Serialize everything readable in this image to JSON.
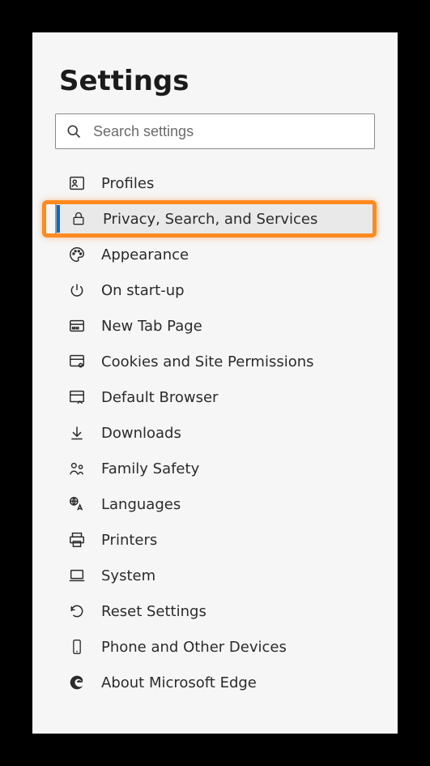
{
  "header": {
    "title": "Settings"
  },
  "search": {
    "placeholder": "Search settings",
    "value": ""
  },
  "nav": {
    "items": [
      {
        "id": "profiles",
        "label": "Profiles",
        "icon": "profile-card-icon",
        "selected": false
      },
      {
        "id": "privacy",
        "label": "Privacy, Search, and Services",
        "icon": "lock-icon",
        "selected": true
      },
      {
        "id": "appearance",
        "label": "Appearance",
        "icon": "palette-icon",
        "selected": false
      },
      {
        "id": "startup",
        "label": "On start-up",
        "icon": "power-icon",
        "selected": false
      },
      {
        "id": "newtab",
        "label": "New Tab Page",
        "icon": "new-tab-icon",
        "selected": false
      },
      {
        "id": "cookies",
        "label": "Cookies and Site Permissions",
        "icon": "site-perm-icon",
        "selected": false
      },
      {
        "id": "defaultbrowser",
        "label": "Default Browser",
        "icon": "browser-icon",
        "selected": false
      },
      {
        "id": "downloads",
        "label": "Downloads",
        "icon": "download-icon",
        "selected": false
      },
      {
        "id": "family",
        "label": "Family Safety",
        "icon": "family-icon",
        "selected": false
      },
      {
        "id": "languages",
        "label": "Languages",
        "icon": "language-icon",
        "selected": false
      },
      {
        "id": "printers",
        "label": "Printers",
        "icon": "printer-icon",
        "selected": false
      },
      {
        "id": "system",
        "label": "System",
        "icon": "laptop-icon",
        "selected": false
      },
      {
        "id": "reset",
        "label": "Reset Settings",
        "icon": "reset-icon",
        "selected": false
      },
      {
        "id": "phone",
        "label": "Phone and Other Devices",
        "icon": "phone-icon",
        "selected": false
      },
      {
        "id": "about",
        "label": "About Microsoft Edge",
        "icon": "edge-icon",
        "selected": false
      }
    ]
  }
}
